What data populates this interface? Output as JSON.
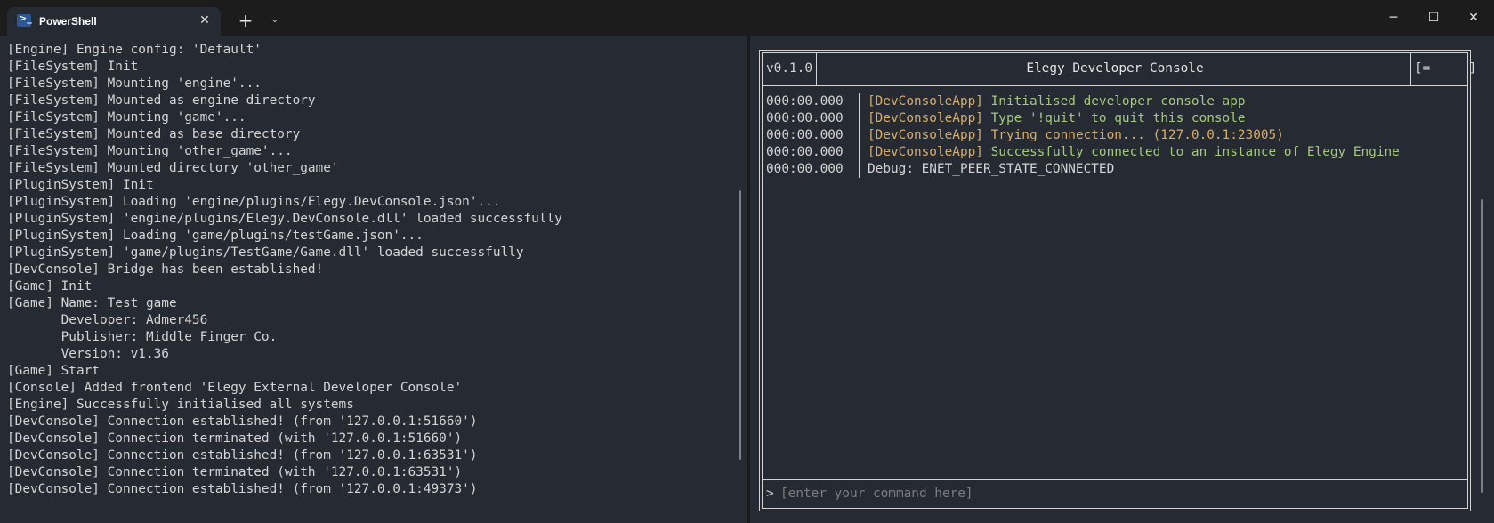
{
  "titlebar": {
    "tab_title": "PowerShell",
    "tab_icon": "powershell-icon",
    "tab_close": "✕",
    "new_tab": "+",
    "dropdown": "⌄",
    "minimize": "─",
    "maximize": "☐",
    "close": "✕"
  },
  "left_console": {
    "lines": [
      "[Engine] Engine config: 'Default'",
      "[FileSystem] Init",
      "[FileSystem] Mounting 'engine'...",
      "[FileSystem] Mounted as engine directory",
      "[FileSystem] Mounting 'game'...",
      "[FileSystem] Mounted as base directory",
      "[FileSystem] Mounting 'other_game'...",
      "[FileSystem] Mounted directory 'other_game'",
      "[PluginSystem] Init",
      "[PluginSystem] Loading 'engine/plugins/Elegy.DevConsole.json'...",
      "[PluginSystem] 'engine/plugins/Elegy.DevConsole.dll' loaded successfully",
      "[PluginSystem] Loading 'game/plugins/testGame.json'...",
      "[PluginSystem] 'game/plugins/TestGame/Game.dll' loaded successfully",
      "[DevConsole] Bridge has been established!",
      "[Game] Init",
      "[Game] Name: Test game",
      "       Developer: Admer456",
      "       Publisher: Middle Finger Co.",
      "       Version: v1.36",
      "[Game] Start",
      "[Console] Added frontend 'Elegy External Developer Console'",
      "[Engine] Successfully initialised all systems",
      "[DevConsole] Connection established! (from '127.0.0.1:51660')",
      "[DevConsole] Connection terminated (with '127.0.0.1:51660')",
      "[DevConsole] Connection established! (from '127.0.0.1:63531')",
      "[DevConsole] Connection terminated (with '127.0.0.1:63531')",
      "[DevConsole] Connection established! (from '127.0.0.1:49373')"
    ]
  },
  "dev_console": {
    "version": "v0.1.0",
    "title": "Elegy Developer Console",
    "menu_button": "[=     ]",
    "log": [
      {
        "time": "000:00.000",
        "source": "[DevConsoleApp]",
        "message": "Initialised developer console app",
        "level": "ok"
      },
      {
        "time": "000:00.000",
        "source": "[DevConsoleApp]",
        "message": "Type '!quit' to quit this console",
        "level": "ok"
      },
      {
        "time": "000:00.000",
        "source": "[DevConsoleApp]",
        "message": "Trying connection... (127.0.0.1:23005)",
        "level": "warn"
      },
      {
        "time": "000:00.000",
        "source": "[DevConsoleApp]",
        "message": "Successfully connected to an instance of Elegy Engine",
        "level": "ok"
      },
      {
        "time": "000:00.000",
        "source": "",
        "message": "Debug: ENET_PEER_STATE_CONNECTED",
        "level": "plain"
      }
    ],
    "prompt": ">",
    "input_placeholder": "[enter your command here]",
    "input_value": ""
  },
  "colors": {
    "background": "#262a33",
    "titlebar": "#1c1c1c",
    "text": "#d4d4d4",
    "source": "#d7ad6a",
    "success": "#a4c87d"
  }
}
